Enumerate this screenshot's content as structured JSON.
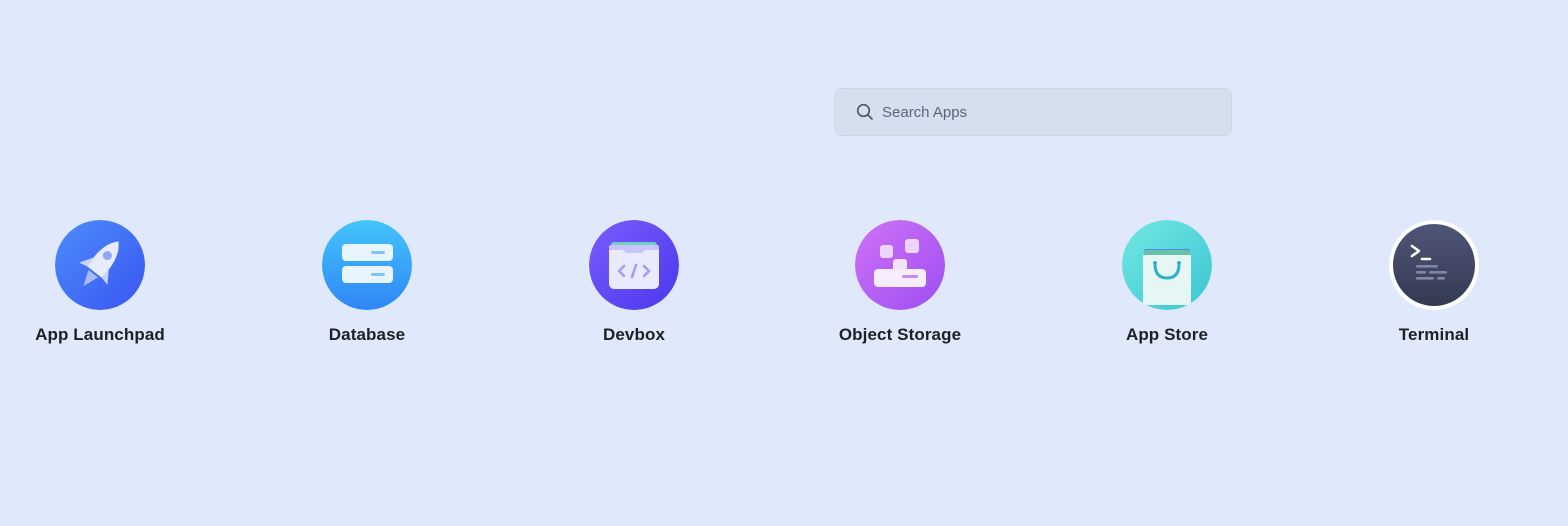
{
  "search": {
    "placeholder": "Search Apps",
    "value": "",
    "icon": "search-icon"
  },
  "apps": [
    {
      "label": "App Launchpad",
      "icon": "rocket-icon",
      "color": "#3f6df7"
    },
    {
      "label": "Database",
      "icon": "database-icon",
      "color": "#36a6f8"
    },
    {
      "label": "Devbox",
      "icon": "code-folder-icon",
      "color": "#5b45f4"
    },
    {
      "label": "Object Storage",
      "icon": "object-storage-icon",
      "color": "#b35cf2"
    },
    {
      "label": "App Store",
      "icon": "shopping-bag-icon",
      "color": "#4fd6d2"
    },
    {
      "label": "Terminal",
      "icon": "terminal-icon",
      "color": "#3f4660"
    }
  ],
  "colors": {
    "background": "#e0e9fb",
    "search_background": "#d6dfee",
    "label_text": "#1d2027"
  }
}
